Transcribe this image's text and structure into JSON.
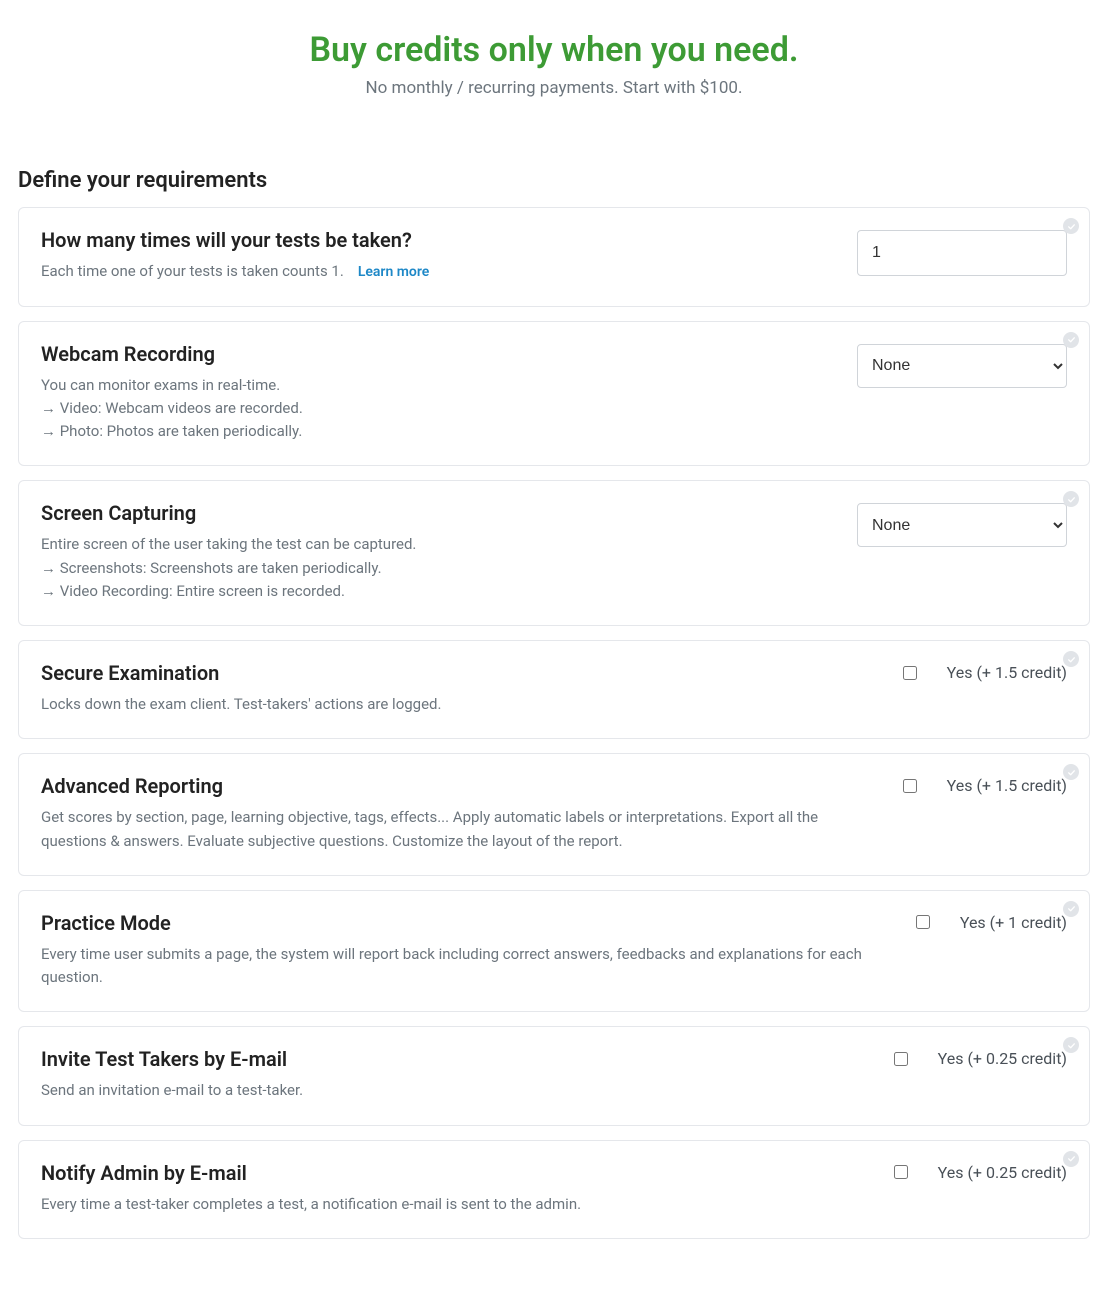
{
  "hero": {
    "title": "Buy credits only when you need.",
    "sub": "No monthly / recurring payments. Start with $100."
  },
  "section_title": "Define your requirements",
  "learn_more": "Learn more",
  "items": [
    {
      "key": "test-count",
      "title": "How many times will your tests be taken?",
      "desc_lines": [
        "Each time one of your tests is taken counts 1."
      ],
      "has_learn_more": true,
      "control": {
        "type": "number",
        "value": "1"
      }
    },
    {
      "key": "webcam-recording",
      "title": "Webcam Recording",
      "desc_lines": [
        "You can monitor exams in real-time.",
        "→ Video: Webcam videos are recorded.",
        "→ Photo: Photos are taken periodically."
      ],
      "control": {
        "type": "select",
        "value": "None"
      }
    },
    {
      "key": "screen-capturing",
      "title": "Screen Capturing",
      "desc_lines": [
        "Entire screen of the user taking the test can be captured.",
        "→ Screenshots: Screenshots are taken periodically.",
        "→ Video Recording: Entire screen is recorded."
      ],
      "control": {
        "type": "select",
        "value": "None"
      }
    },
    {
      "key": "secure-examination",
      "title": "Secure Examination",
      "desc_lines": [
        "Locks down the exam client. Test-takers' actions are logged."
      ],
      "control": {
        "type": "checkbox",
        "label": "Yes (+ 1.5 credit)",
        "checked": false
      }
    },
    {
      "key": "advanced-reporting",
      "title": "Advanced Reporting",
      "desc_lines": [
        "Get scores by section, page, learning objective, tags, effects... Apply automatic labels or interpretations. Export all the questions & answers. Evaluate subjective questions. Customize the layout of the report."
      ],
      "control": {
        "type": "checkbox",
        "label": "Yes (+ 1.5 credit)",
        "checked": false
      }
    },
    {
      "key": "practice-mode",
      "title": "Practice Mode",
      "desc_lines": [
        "Every time user submits a page, the system will report back including correct answers, feedbacks and explanations for each question."
      ],
      "control": {
        "type": "checkbox",
        "label": "Yes (+ 1 credit)",
        "checked": false
      }
    },
    {
      "key": "invite-test-takers",
      "title": "Invite Test Takers by E-mail",
      "desc_lines": [
        "Send an invitation e-mail to a test-taker."
      ],
      "control": {
        "type": "checkbox",
        "label": "Yes (+ 0.25 credit)",
        "checked": false
      }
    },
    {
      "key": "notify-admin",
      "title": "Notify Admin by E-mail",
      "desc_lines": [
        "Every time a test-taker completes a test, a notification e-mail is sent to the admin."
      ],
      "control": {
        "type": "checkbox",
        "label": "Yes (+ 0.25 credit)",
        "checked": false
      }
    }
  ]
}
